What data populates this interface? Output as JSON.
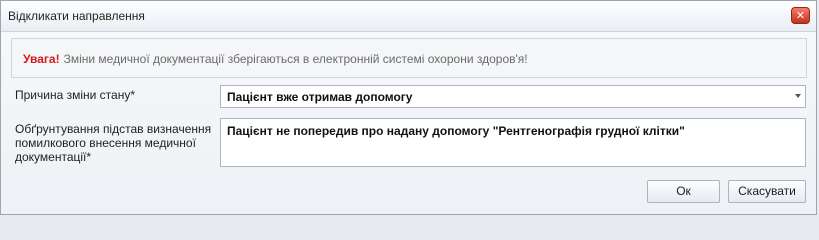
{
  "dialog": {
    "title": "Відкликати направлення",
    "close_icon": "close-icon"
  },
  "alert": {
    "strong": "Увага!",
    "message": "Зміни медичної документації зберігаються в електронній системі охорони здоров'я!",
    "color_strong": "#d2191d"
  },
  "form": {
    "reason_label": "Причина зміни стану*",
    "reason_value": "Пацієнт вже отримав допомогу",
    "justification_label": "Обґрунтування підстав визначення помилкового внесення медичної документації*",
    "justification_value": "Пацієнт не попередив про надану допомогу \"Рентгенографія грудної клітки\""
  },
  "buttons": {
    "ok": "Ок",
    "cancel": "Скасувати"
  }
}
